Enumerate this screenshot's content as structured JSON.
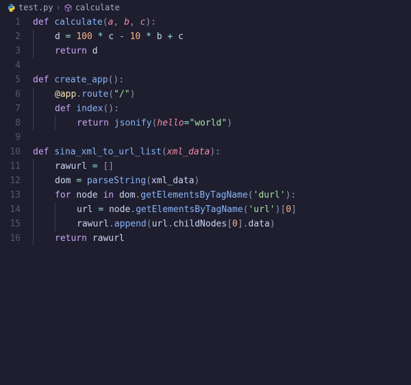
{
  "breadcrumb": {
    "file_icon": "python-file-icon",
    "file": "test.py",
    "sep": "›",
    "symbol_icon": "symbol-method-icon",
    "symbol": "calculate"
  },
  "lines": [
    {
      "n": 1,
      "indent": 0,
      "tokens": [
        {
          "t": "def ",
          "c": "kw"
        },
        {
          "t": "calculate",
          "c": "fn"
        },
        {
          "t": "(",
          "c": "pun"
        },
        {
          "t": "a",
          "c": "par"
        },
        {
          "t": ", ",
          "c": "pun"
        },
        {
          "t": "b",
          "c": "par"
        },
        {
          "t": ", ",
          "c": "pun"
        },
        {
          "t": "c",
          "c": "par"
        },
        {
          "t": "):",
          "c": "pun"
        }
      ]
    },
    {
      "n": 2,
      "indent": 1,
      "guides": [
        0
      ],
      "tokens": [
        {
          "t": "d ",
          "c": "var"
        },
        {
          "t": "= ",
          "c": "op"
        },
        {
          "t": "100 ",
          "c": "num"
        },
        {
          "t": "* ",
          "c": "op"
        },
        {
          "t": "c ",
          "c": "var"
        },
        {
          "t": "- ",
          "c": "op"
        },
        {
          "t": "10 ",
          "c": "num"
        },
        {
          "t": "* ",
          "c": "op"
        },
        {
          "t": "b ",
          "c": "var"
        },
        {
          "t": "+ ",
          "c": "op"
        },
        {
          "t": "c",
          "c": "var"
        }
      ]
    },
    {
      "n": 3,
      "indent": 1,
      "guides": [
        0
      ],
      "tokens": [
        {
          "t": "return ",
          "c": "kw"
        },
        {
          "t": "d",
          "c": "var"
        }
      ]
    },
    {
      "n": 4,
      "indent": 0,
      "tokens": []
    },
    {
      "n": 5,
      "indent": 0,
      "tokens": [
        {
          "t": "def ",
          "c": "kw"
        },
        {
          "t": "create_app",
          "c": "fn"
        },
        {
          "t": "():",
          "c": "pun"
        }
      ]
    },
    {
      "n": 6,
      "indent": 1,
      "guides": [
        0
      ],
      "tokens": [
        {
          "t": "@app",
          "c": "dec"
        },
        {
          "t": ".",
          "c": "pun"
        },
        {
          "t": "route",
          "c": "prop"
        },
        {
          "t": "(",
          "c": "pun"
        },
        {
          "t": "\"/\"",
          "c": "str"
        },
        {
          "t": ")",
          "c": "pun"
        }
      ]
    },
    {
      "n": 7,
      "indent": 1,
      "guides": [
        0
      ],
      "tokens": [
        {
          "t": "def ",
          "c": "kw"
        },
        {
          "t": "index",
          "c": "fn"
        },
        {
          "t": "():",
          "c": "pun"
        }
      ]
    },
    {
      "n": 8,
      "indent": 2,
      "guides": [
        0,
        1
      ],
      "tokens": [
        {
          "t": "return ",
          "c": "kw"
        },
        {
          "t": "jsonify",
          "c": "fn"
        },
        {
          "t": "(",
          "c": "pun"
        },
        {
          "t": "hello",
          "c": "kwarg"
        },
        {
          "t": "=",
          "c": "op"
        },
        {
          "t": "\"world\"",
          "c": "str"
        },
        {
          "t": ")",
          "c": "pun"
        }
      ]
    },
    {
      "n": 9,
      "indent": 0,
      "tokens": []
    },
    {
      "n": 10,
      "indent": 0,
      "tokens": [
        {
          "t": "def ",
          "c": "kw"
        },
        {
          "t": "sina_xml_to_url_list",
          "c": "fn"
        },
        {
          "t": "(",
          "c": "pun"
        },
        {
          "t": "xml_data",
          "c": "par"
        },
        {
          "t": "):",
          "c": "pun"
        }
      ]
    },
    {
      "n": 11,
      "indent": 1,
      "guides": [
        0
      ],
      "tokens": [
        {
          "t": "rawurl ",
          "c": "var"
        },
        {
          "t": "= ",
          "c": "op"
        },
        {
          "t": "[]",
          "c": "pun"
        }
      ]
    },
    {
      "n": 12,
      "indent": 1,
      "guides": [
        0
      ],
      "tokens": [
        {
          "t": "dom ",
          "c": "var"
        },
        {
          "t": "= ",
          "c": "op"
        },
        {
          "t": "parseString",
          "c": "fn"
        },
        {
          "t": "(",
          "c": "pun"
        },
        {
          "t": "xml_data",
          "c": "var"
        },
        {
          "t": ")",
          "c": "pun"
        }
      ]
    },
    {
      "n": 13,
      "indent": 1,
      "guides": [
        0
      ],
      "tokens": [
        {
          "t": "for ",
          "c": "kw"
        },
        {
          "t": "node ",
          "c": "var"
        },
        {
          "t": "in ",
          "c": "kw"
        },
        {
          "t": "dom",
          "c": "var"
        },
        {
          "t": ".",
          "c": "pun"
        },
        {
          "t": "getElementsByTagName",
          "c": "prop"
        },
        {
          "t": "(",
          "c": "pun"
        },
        {
          "t": "'durl'",
          "c": "str"
        },
        {
          "t": "):",
          "c": "pun"
        }
      ]
    },
    {
      "n": 14,
      "indent": 2,
      "guides": [
        0,
        1
      ],
      "tokens": [
        {
          "t": "url ",
          "c": "var"
        },
        {
          "t": "= ",
          "c": "op"
        },
        {
          "t": "node",
          "c": "var"
        },
        {
          "t": ".",
          "c": "pun"
        },
        {
          "t": "getElementsByTagName",
          "c": "prop"
        },
        {
          "t": "(",
          "c": "pun"
        },
        {
          "t": "'url'",
          "c": "str"
        },
        {
          "t": ")[",
          "c": "pun"
        },
        {
          "t": "0",
          "c": "num"
        },
        {
          "t": "]",
          "c": "pun"
        }
      ]
    },
    {
      "n": 15,
      "indent": 2,
      "guides": [
        0,
        1
      ],
      "tokens": [
        {
          "t": "rawurl",
          "c": "var"
        },
        {
          "t": ".",
          "c": "pun"
        },
        {
          "t": "append",
          "c": "prop"
        },
        {
          "t": "(",
          "c": "pun"
        },
        {
          "t": "url",
          "c": "var"
        },
        {
          "t": ".",
          "c": "pun"
        },
        {
          "t": "childNodes",
          "c": "var"
        },
        {
          "t": "[",
          "c": "pun"
        },
        {
          "t": "0",
          "c": "num"
        },
        {
          "t": "].",
          "c": "pun"
        },
        {
          "t": "data",
          "c": "var"
        },
        {
          "t": ")",
          "c": "pun"
        }
      ]
    },
    {
      "n": 16,
      "indent": 1,
      "guides": [
        0
      ],
      "tokens": [
        {
          "t": "return ",
          "c": "kw"
        },
        {
          "t": "rawurl",
          "c": "var"
        }
      ]
    }
  ],
  "colors": {
    "background": "#1e1e2e",
    "gutter": "#515870",
    "guide": "#3b3f52"
  }
}
